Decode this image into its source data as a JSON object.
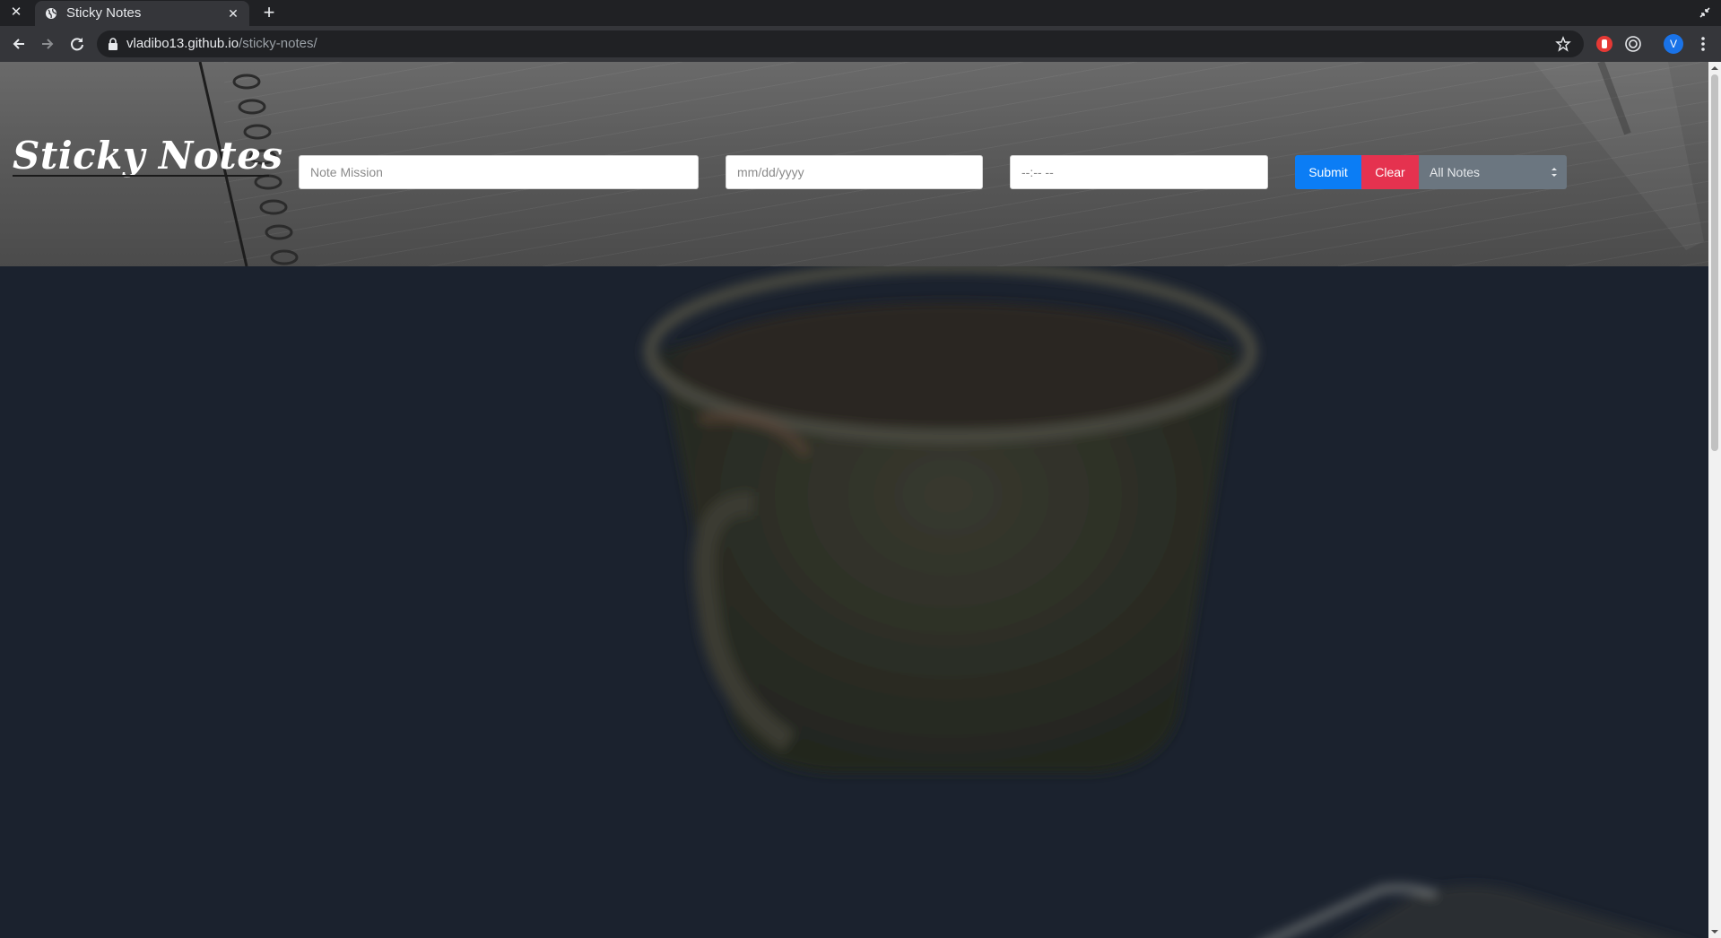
{
  "browser": {
    "tab": {
      "title": "Sticky Notes"
    },
    "url": {
      "host": "vladibo13.github.io",
      "path": "/sticky-notes/"
    },
    "profile_initial": "V"
  },
  "page": {
    "logo": "Sticky Notes",
    "form": {
      "mission_placeholder": "Note Mission",
      "date_placeholder": "mm/dd/yyyy",
      "time_placeholder": "--:-- --",
      "submit_label": "Submit",
      "clear_label": "Clear",
      "filter_selected": "All Notes"
    }
  },
  "colors": {
    "submit": "#0b7df5",
    "clear": "#e5324f",
    "select": "#6b7680"
  }
}
